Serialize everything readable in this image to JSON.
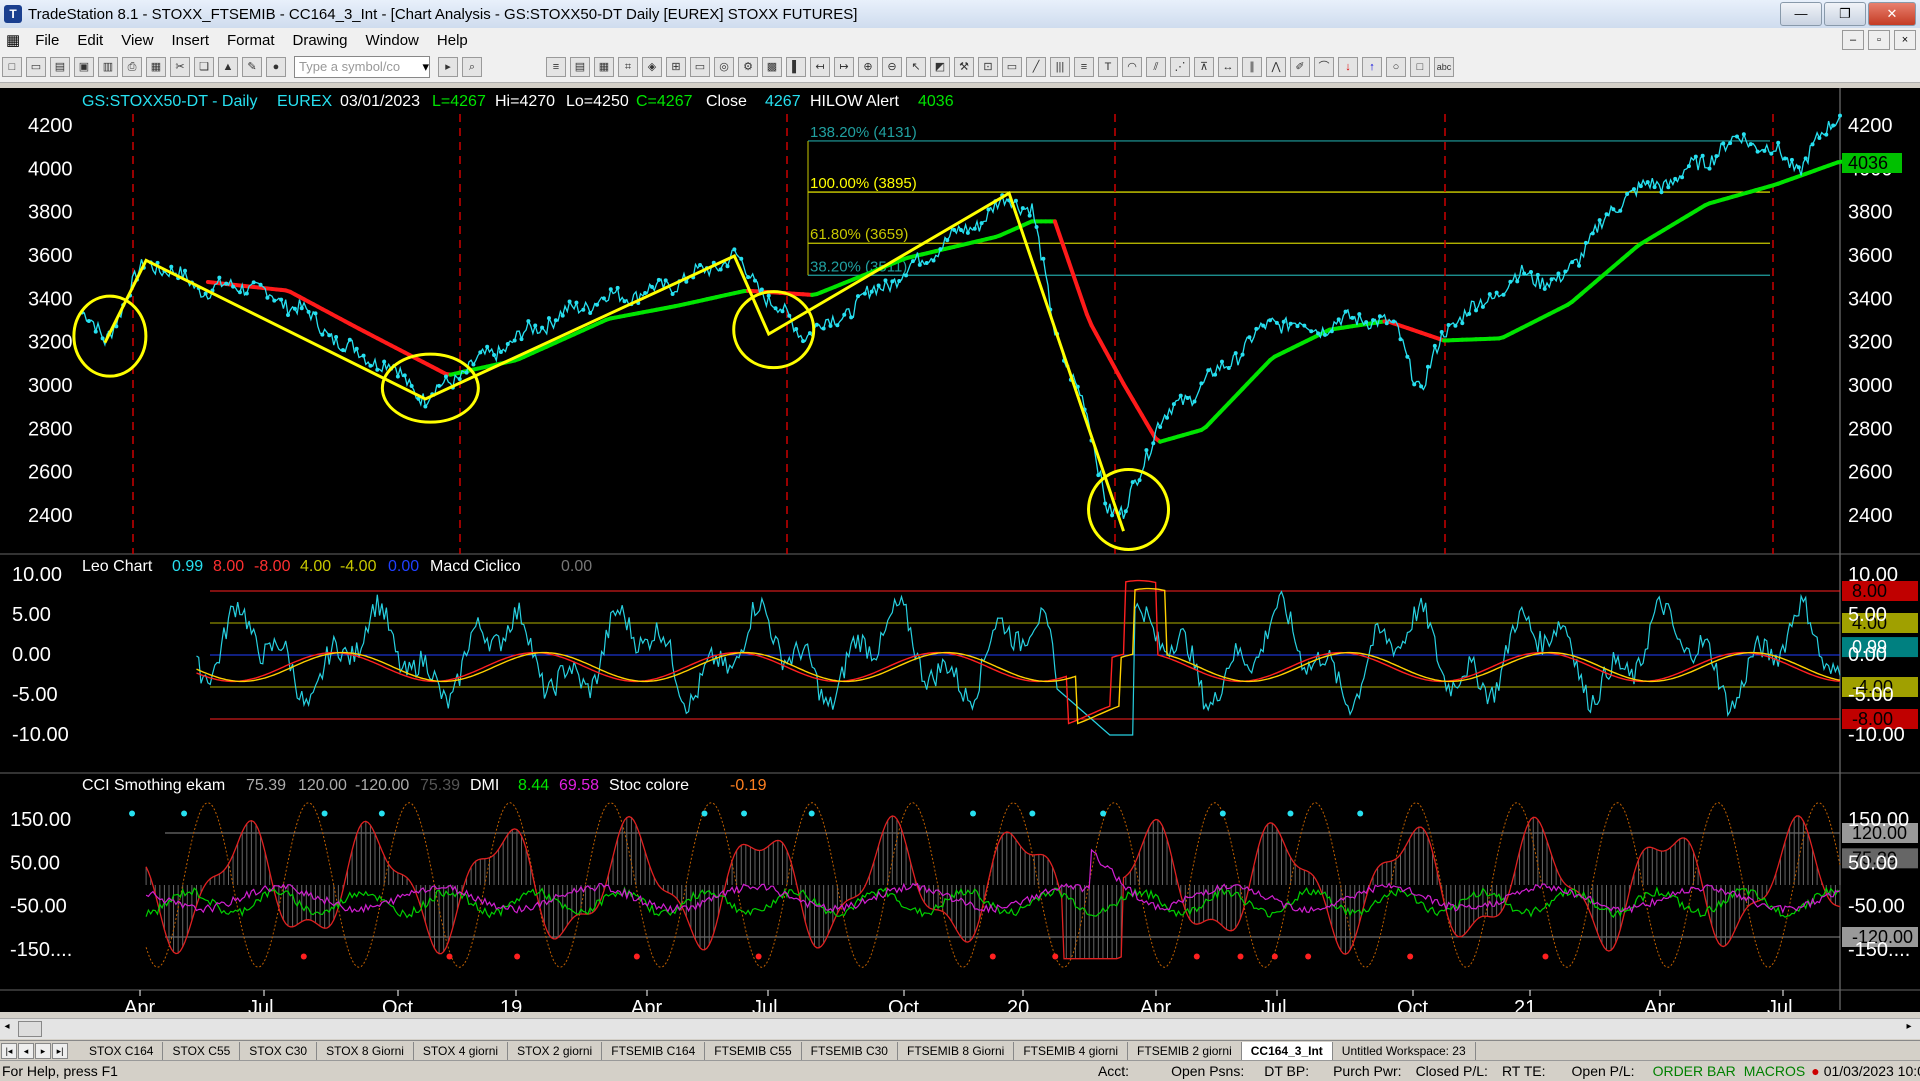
{
  "window": {
    "title": "TradeStation 8.1 - STOXX_FTSEMIB - CC164_3_Int - [Chart Analysis - GS:STOXX50-DT  Daily  [EUREX] STOXX FUTURES]"
  },
  "menu": [
    "File",
    "Edit",
    "View",
    "Insert",
    "Format",
    "Drawing",
    "Window",
    "Help"
  ],
  "toolbar": {
    "symbol_placeholder": "Type a symbol/co"
  },
  "chart": {
    "header": {
      "symbol": "GS:STOXX50-DT - Daily",
      "exchange": "EUREX",
      "date": "03/01/2023",
      "last": "L=4267",
      "high": "Hi=4270",
      "low": "Lo=4250",
      "close": "C=4267",
      "close_label": "Close",
      "close_value": "4267",
      "hilow_label": "HILOW Alert",
      "hilow_value": "4036"
    },
    "price_axis": [
      "4200",
      "4000",
      "3800",
      "3600",
      "3400",
      "3200",
      "3000",
      "2800",
      "2600",
      "2400"
    ],
    "fib_levels": [
      "138.20% (4131)",
      "100.00% (3895)",
      "61.80% (3659)",
      "38.20% (3511)"
    ],
    "price_tags": {
      "last": "4036"
    },
    "leo": {
      "name": "Leo Chart",
      "values": [
        "0.99",
        "8.00",
        "-8.00",
        "4.00",
        "-4.00",
        "0.00"
      ],
      "macd_label": "Macd Ciclico",
      "macd_value": "0.00",
      "axis": [
        "10.00",
        "5.00",
        "0.00",
        "-5.00",
        "-10.00"
      ],
      "tags": [
        "8.00",
        "4.00",
        "0.99",
        "-4.00",
        "-8.00"
      ]
    },
    "cci": {
      "name": "CCI Smothing ekam",
      "values": [
        "75.39",
        "120.00",
        "-120.00",
        "75.39"
      ],
      "dmi_label": "DMI",
      "dmi_values": [
        "8.44",
        "69.58"
      ],
      "stoc_label": "Stoc colore",
      "stoc_value": "-0.19",
      "axis": [
        "150.00",
        "50.00",
        "-50.00",
        "-150...."
      ],
      "tags": [
        "120.00",
        "75.39",
        "-120.00"
      ]
    },
    "time_axis": [
      "Apr",
      "Jul",
      "Oct",
      "19",
      "Apr",
      "Jul",
      "Oct",
      "20",
      "Apr",
      "Jul",
      "Oct",
      "21",
      "Apr",
      "Jul"
    ],
    "colors": {
      "price": "#27e0f0",
      "ma_up": "#00e400",
      "ma_down": "#ff1a1a",
      "zigzag": "#ffff00",
      "fib": "#c8c800"
    }
  },
  "chart_data": {
    "type": "line",
    "title": "GS:STOXX50-DT - Daily",
    "ylim": [
      2300,
      4270
    ],
    "series": [
      {
        "name": "Close",
        "points": [
          [
            0,
            3340
          ],
          [
            10,
            3210
          ],
          [
            28,
            3580
          ],
          [
            55,
            3440
          ],
          [
            70,
            3470
          ],
          [
            95,
            3360
          ],
          [
            115,
            3180
          ],
          [
            135,
            3090
          ],
          [
            150,
            2940
          ],
          [
            170,
            3090
          ],
          [
            200,
            3280
          ],
          [
            225,
            3400
          ],
          [
            250,
            3440
          ],
          [
            270,
            3520
          ],
          [
            285,
            3600
          ],
          [
            300,
            3400
          ],
          [
            315,
            3240
          ],
          [
            330,
            3310
          ],
          [
            345,
            3430
          ],
          [
            360,
            3530
          ],
          [
            375,
            3650
          ],
          [
            392,
            3760
          ],
          [
            405,
            3870
          ],
          [
            415,
            3820
          ],
          [
            425,
            3250
          ],
          [
            438,
            2900
          ],
          [
            448,
            2450
          ],
          [
            455,
            2400
          ],
          [
            470,
            2830
          ],
          [
            480,
            2920
          ],
          [
            500,
            3100
          ],
          [
            520,
            3300
          ],
          [
            540,
            3270
          ],
          [
            560,
            3320
          ],
          [
            575,
            3260
          ],
          [
            585,
            2960
          ],
          [
            595,
            3260
          ],
          [
            615,
            3410
          ],
          [
            630,
            3520
          ],
          [
            645,
            3470
          ],
          [
            660,
            3690
          ],
          [
            675,
            3890
          ],
          [
            695,
            3950
          ],
          [
            710,
            4050
          ],
          [
            725,
            4150
          ],
          [
            740,
            4080
          ],
          [
            750,
            4000
          ],
          [
            760,
            4150
          ],
          [
            768,
            4267
          ]
        ]
      },
      {
        "name": "HILOW Alert",
        "points": [
          [
            55,
            3480
          ],
          [
            90,
            3440
          ],
          [
            120,
            3270
          ],
          [
            140,
            3160
          ],
          [
            160,
            3050
          ],
          [
            190,
            3120
          ],
          [
            230,
            3310
          ],
          [
            260,
            3370
          ],
          [
            290,
            3440
          ],
          [
            320,
            3420
          ],
          [
            360,
            3590
          ],
          [
            400,
            3690
          ],
          [
            415,
            3760
          ],
          [
            425,
            3760
          ],
          [
            440,
            3300
          ],
          [
            455,
            3010
          ],
          [
            470,
            2740
          ],
          [
            490,
            2800
          ],
          [
            520,
            3130
          ],
          [
            545,
            3260
          ],
          [
            570,
            3300
          ],
          [
            595,
            3210
          ],
          [
            620,
            3220
          ],
          [
            650,
            3380
          ],
          [
            680,
            3650
          ],
          [
            710,
            3840
          ],
          [
            740,
            3930
          ],
          [
            768,
            4036
          ]
        ]
      }
    ],
    "fibonacci": [
      {
        "level": "138.20%",
        "value": 4131
      },
      {
        "level": "100.00%",
        "value": 3895
      },
      {
        "level": "61.80%",
        "value": 3659
      },
      {
        "level": "38.20%",
        "value": 3511
      }
    ],
    "xlabels": [
      "Apr",
      "Jul",
      "Oct",
      "19",
      "Apr",
      "Jul",
      "Oct",
      "20",
      "Apr",
      "Jul",
      "Oct",
      "21",
      "Apr",
      "Jul"
    ]
  }
}
